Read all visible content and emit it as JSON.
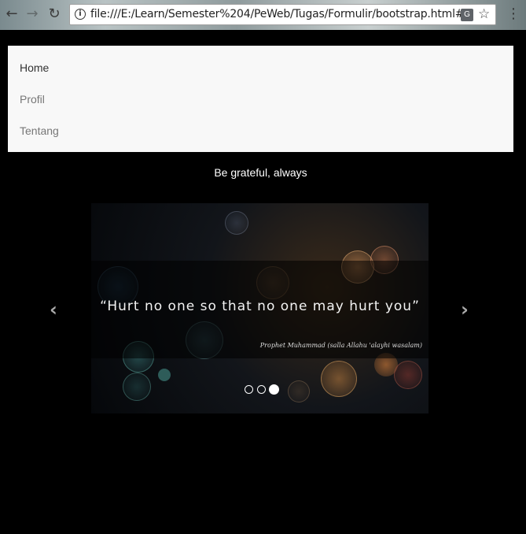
{
  "browser": {
    "url": "file:///E:/Learn/Semester%204/PeWeb/Tugas/Formulir/bootstrap.html#",
    "back_icon": "back-arrow-icon",
    "forward_icon": "forward-arrow-icon",
    "reload_icon": "reload-icon",
    "info_icon": "info-icon",
    "translate_icon": "translate-icon",
    "bookmark_icon": "star-icon",
    "menu_icon": "kebab-menu-icon"
  },
  "navbar": {
    "items": [
      {
        "label": "Home",
        "active": true
      },
      {
        "label": "Profil",
        "active": false
      },
      {
        "label": "Tentang",
        "active": false
      }
    ]
  },
  "tagline": "Be grateful, always",
  "carousel": {
    "quote": "“Hurt no one so that no one may hurt you”",
    "attribution": "Prophet Muhammad (salla Allahu 'alayhi wasalam)",
    "prev_icon": "chevron-left-icon",
    "next_icon": "chevron-right-icon",
    "indicators": 3,
    "active_index": 2
  },
  "colors": {
    "page_bg": "#000000",
    "navbar_bg": "#f8f8f8",
    "nav_link": "#777777",
    "nav_link_active": "#333333"
  }
}
